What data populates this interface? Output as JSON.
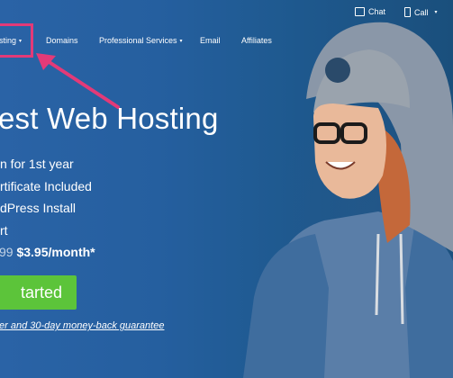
{
  "utility_bar": {
    "chat_label": "Chat",
    "call_label": "Call",
    "call_caret": "▾",
    "chat_icon": "chat-bubble-icon",
    "call_icon": "phone-icon"
  },
  "nav": {
    "items": [
      {
        "label": "sting",
        "caret": "▾"
      },
      {
        "label": "Domains"
      },
      {
        "label": "Professional Services",
        "caret": "▾"
      },
      {
        "label": "Email"
      },
      {
        "label": "Affiliates"
      }
    ]
  },
  "hero": {
    "title": "est Web Hosting",
    "features": [
      "n for 1st year",
      "rtificate Included",
      "dPress Install",
      "rt"
    ],
    "price_old": "99",
    "price_new": "$3.95/month*",
    "cta_label": "tarted",
    "guarantee": "er and 30-day money-back guarantee"
  },
  "colors": {
    "highlight": "#e33a78",
    "cta": "#5cc43a",
    "background": "#2a63a6"
  }
}
